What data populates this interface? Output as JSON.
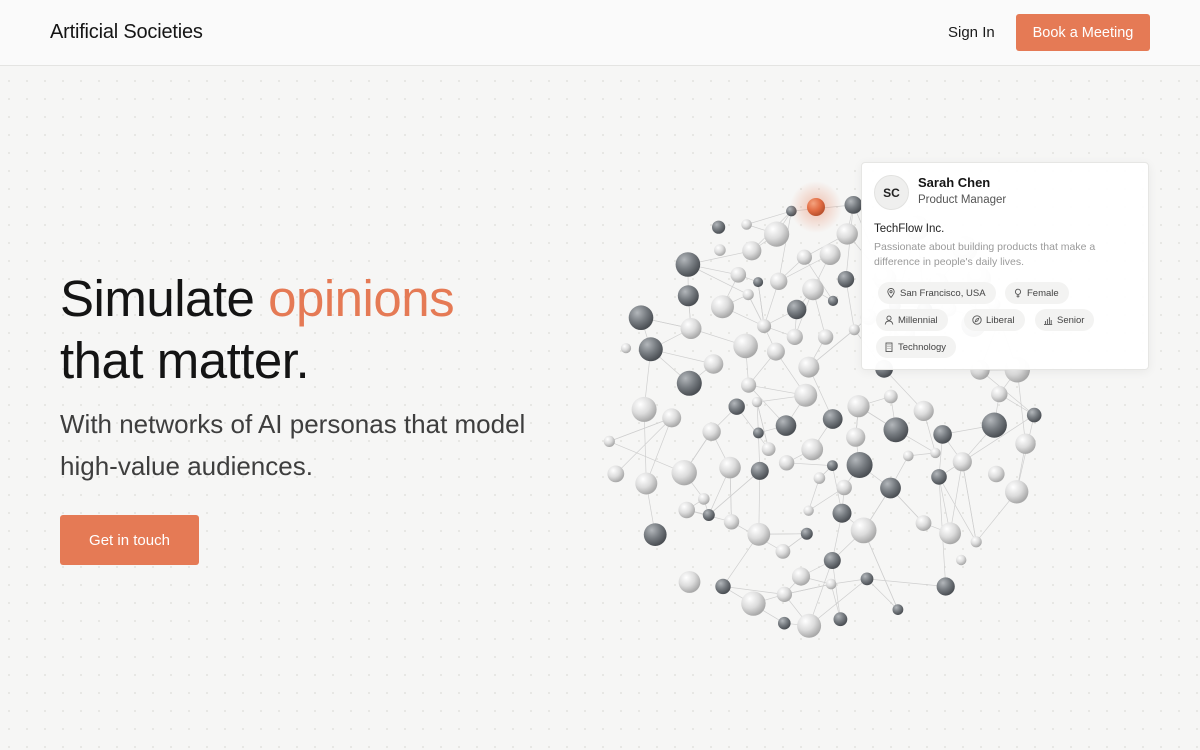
{
  "header": {
    "brand": "Artificial Societies",
    "sign_in": "Sign In",
    "book_meeting": "Book a Meeting"
  },
  "hero": {
    "title_part1": "Simulate ",
    "title_accent": "opinions",
    "title_part2": "that matter.",
    "subtitle": "With networks of AI personas that model high-value audiences.",
    "cta": "Get in touch"
  },
  "persona_card": {
    "initials": "SC",
    "name": "Sarah Chen",
    "role": "Product Manager",
    "company": "TechFlow Inc.",
    "bio": "Passionate about building products that make a difference in people's daily lives.",
    "tags": [
      {
        "icon": "location-pin-icon",
        "label": "San Francisco, USA"
      },
      {
        "icon": "gender-icon",
        "label": "Female"
      },
      {
        "icon": "person-icon",
        "label": "Millennial"
      },
      {
        "icon": "compass-icon",
        "label": "Liberal"
      },
      {
        "icon": "bar-chart-icon",
        "label": "Senior"
      },
      {
        "icon": "building-icon",
        "label": "Technology"
      }
    ]
  },
  "colors": {
    "accent": "#e57a55",
    "node_dark": "#6f747a",
    "node_light": "#d9d9d9"
  }
}
